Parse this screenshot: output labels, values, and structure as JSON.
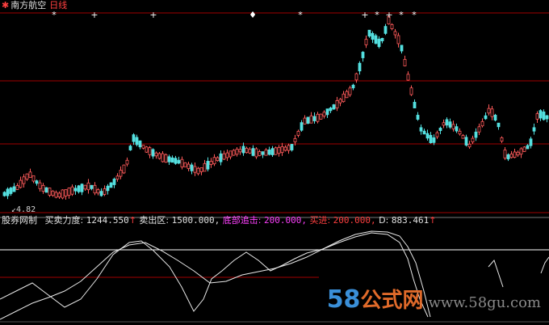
{
  "title": {
    "stock_name": "南方航空",
    "period": "日线"
  },
  "price_low_label": "4.82",
  "signals": [
    "*",
    "+",
    "+",
    "♦",
    "*",
    "+",
    "*",
    "+",
    "*",
    "*"
  ],
  "indicator": {
    "name": "股券网制",
    "items": [
      {
        "label": "买卖力度:",
        "value": "1244.550",
        "arrow": "↑"
      },
      {
        "label": "卖出区:",
        "value": "1500.000,",
        "arrow": ""
      },
      {
        "label": "底部追击:",
        "value": "200.000,",
        "arrow": ""
      },
      {
        "label": "买进:",
        "value": "200.000,",
        "arrow": ""
      },
      {
        "label": "D:",
        "value": "883.461",
        "arrow": "↑"
      }
    ]
  },
  "watermark": {
    "main": "58",
    "main2": "公式网",
    "site": "www.58gu.com"
  },
  "colors": {
    "up": "#ff5a5a",
    "down": "#54e0e0",
    "grid": "#a00000",
    "line": "#e8e8e8",
    "text_white": "#e0e0e0",
    "text_magenta": "#ff40ff",
    "text_red": "#ff4040"
  }
}
